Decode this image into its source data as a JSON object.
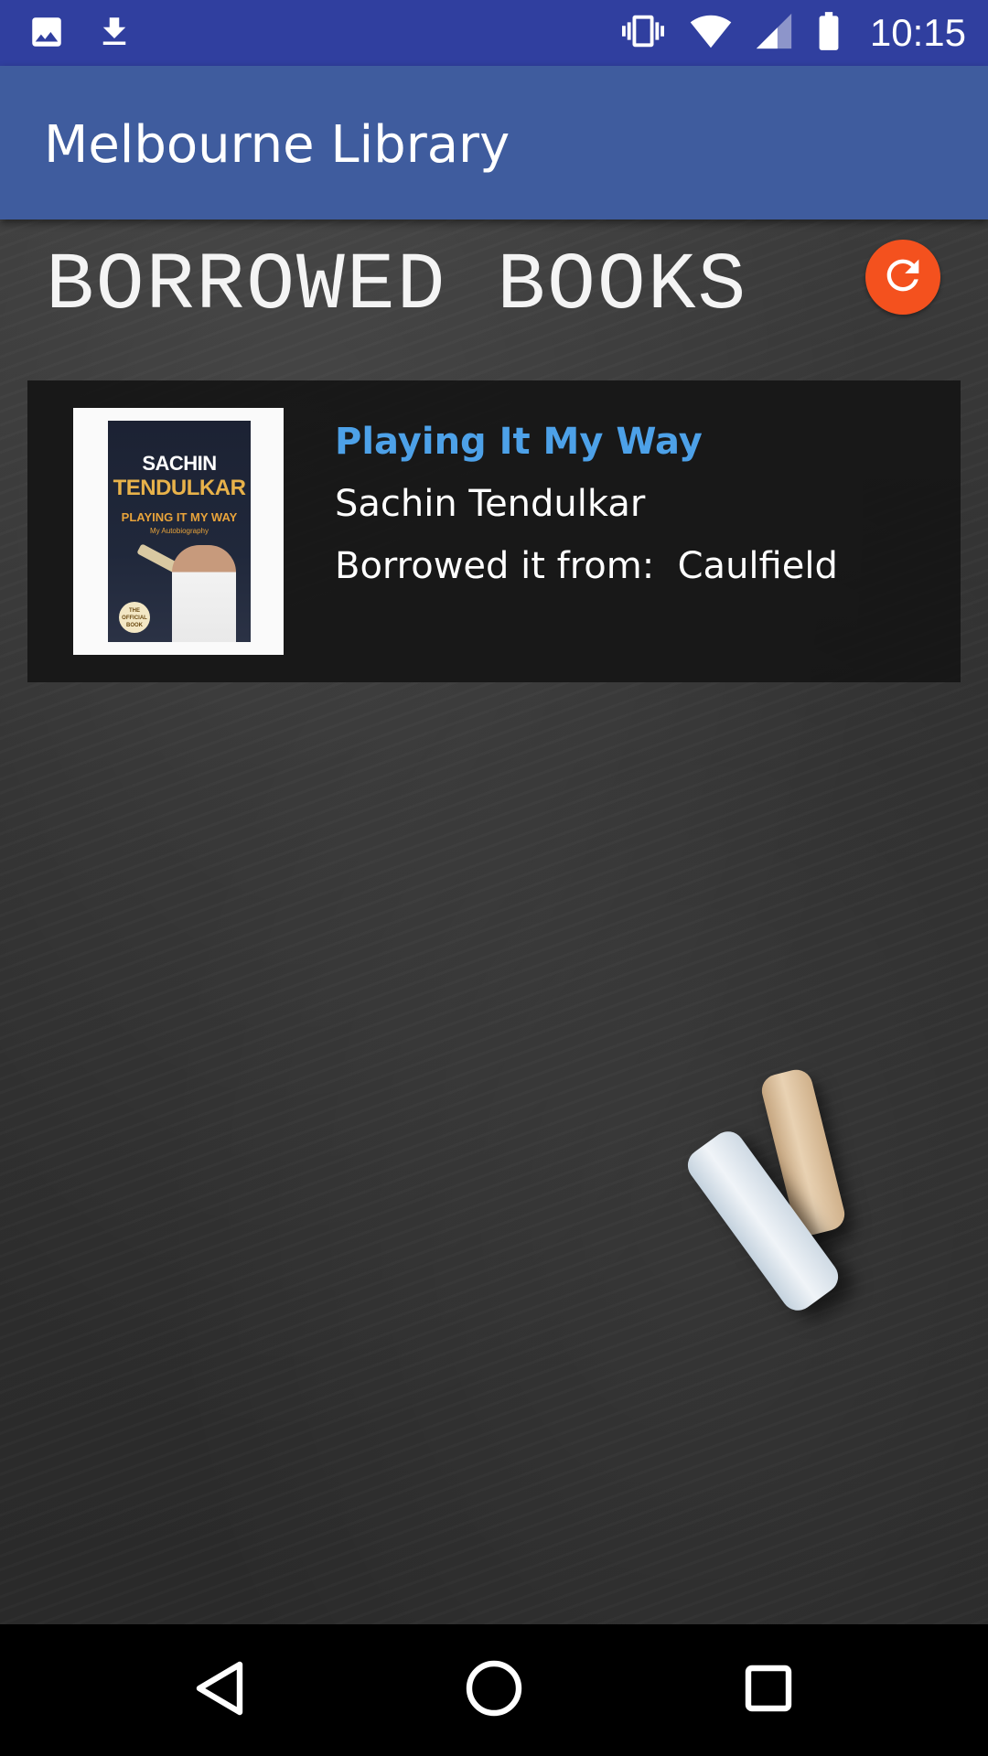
{
  "status_bar": {
    "time": "10:15",
    "left_icons": [
      "image-icon",
      "download-icon"
    ],
    "right_icons": [
      "vibrate-icon",
      "wifi-icon",
      "signal-icon",
      "battery-icon"
    ],
    "background": "#303f9f"
  },
  "app_bar": {
    "title": "Melbourne Library",
    "background": "#3f5c9e"
  },
  "section": {
    "title": "BORROWED BOOKS",
    "refresh_icon": "refresh-icon",
    "refresh_color": "#f4511e"
  },
  "books": [
    {
      "title": "Playing It My Way",
      "author": "Sachin Tendulkar",
      "borrowed_label": "Borrowed it from:  Caulfield",
      "cover": {
        "author_line1": "SACHIN",
        "author_line2": "TENDULKAR",
        "title": "PLAYING IT MY WAY",
        "subtitle": "My Autobiography",
        "seal": "THE OFFICIAL BOOK"
      }
    }
  ],
  "nav_bar": {
    "buttons": [
      "back-icon",
      "home-icon",
      "recents-icon"
    ]
  }
}
